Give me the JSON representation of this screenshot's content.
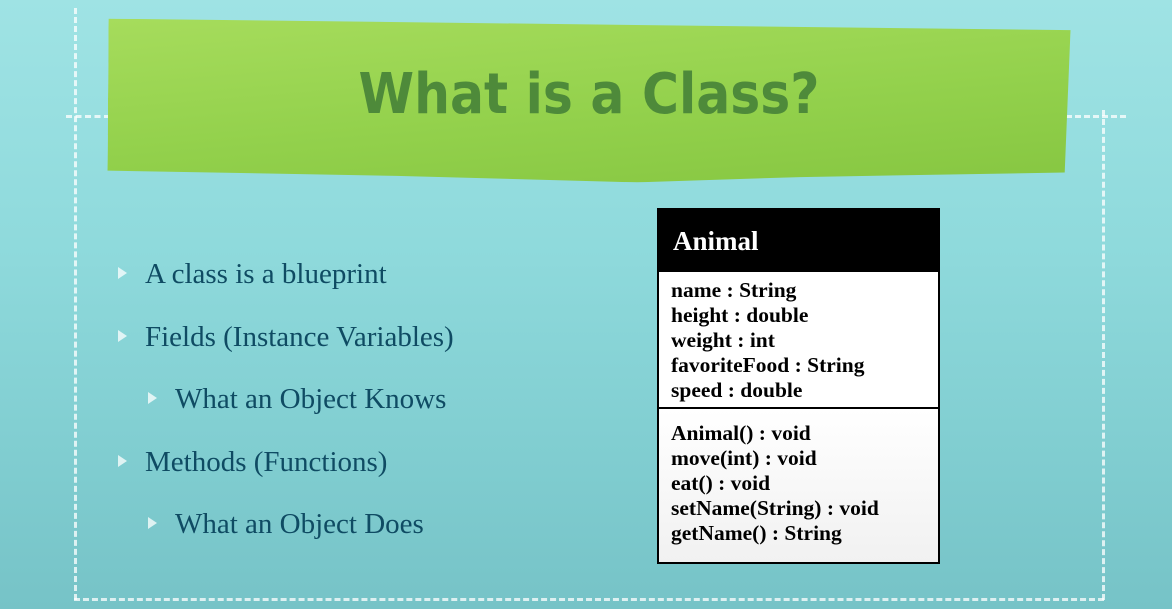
{
  "slide": {
    "title": "What is a Class?",
    "bullets": [
      {
        "text": "A class is a blueprint",
        "level": 1
      },
      {
        "text": "Fields (Instance Variables)",
        "level": 1
      },
      {
        "text": "What an Object Knows",
        "level": 2
      },
      {
        "text": "Methods (Functions)",
        "level": 1
      },
      {
        "text": "What an Object Does",
        "level": 2
      }
    ]
  },
  "uml": {
    "class_name": "Animal",
    "fields": [
      "name : String",
      "height : double",
      "weight : int",
      "favoriteFood : String",
      "speed : double"
    ],
    "methods": [
      "Animal() : void",
      "move(int) : void",
      "eat() : void",
      "setName(String) : void",
      "getName() : String"
    ]
  },
  "colors": {
    "background": "#8fdadc",
    "title_paper": "#93d14c",
    "title_text": "#4e8a3a",
    "bullet_text": "#0f4b63"
  }
}
